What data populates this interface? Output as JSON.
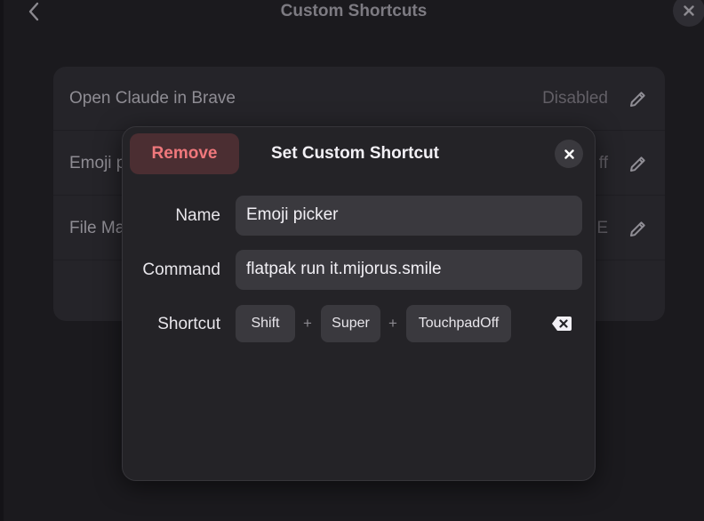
{
  "header": {
    "title": "Custom Shortcuts",
    "back_icon": "chevron-left-icon",
    "close_icon": "close-icon"
  },
  "list": {
    "rows": [
      {
        "label": "Open Claude in Brave",
        "value": "Disabled"
      },
      {
        "label": "Emoji p",
        "value": "ff"
      },
      {
        "label": "File Ma",
        "value": "E"
      }
    ],
    "edit_icon": "pencil-icon"
  },
  "dialog": {
    "remove_label": "Remove",
    "title": "Set Custom Shortcut",
    "name_label": "Name",
    "name_value": "Emoji picker",
    "command_label": "Command",
    "command_value": "flatpak run it.mijorus.smile",
    "shortcut_label": "Shortcut",
    "keys": [
      "Shift",
      "Super",
      "TouchpadOff"
    ],
    "separator": "+",
    "clear_icon": "backspace-icon"
  },
  "colors": {
    "background": "#1b1a1e",
    "dialog": "#242327",
    "destructive": "#f0787c",
    "destructive_bg": "#4b2e32"
  }
}
